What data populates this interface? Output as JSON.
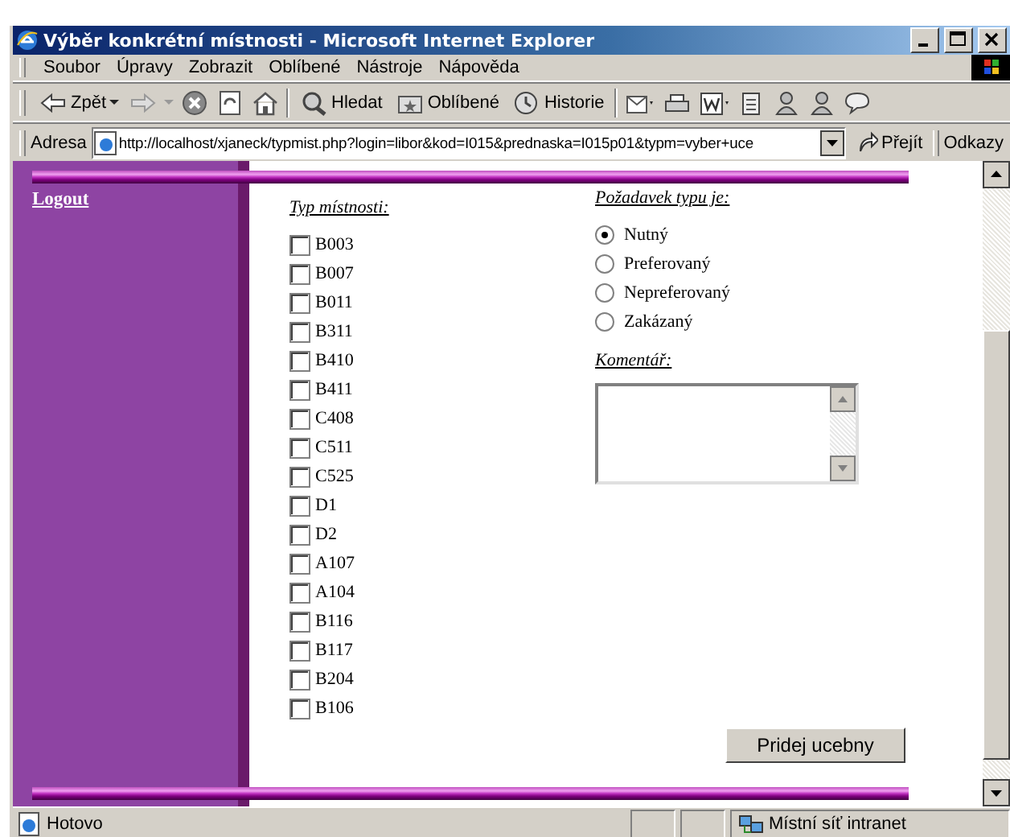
{
  "window": {
    "title": "Výběr konkrétní místnosti - Microsoft Internet Explorer"
  },
  "menu": [
    "Soubor",
    "Úpravy",
    "Zobrazit",
    "Oblíbené",
    "Nástroje",
    "Nápověda"
  ],
  "toolbar": [
    {
      "kind": "back",
      "label": "Zpět"
    },
    {
      "kind": "forward"
    },
    {
      "kind": "stop"
    },
    {
      "kind": "refresh"
    },
    {
      "kind": "home"
    },
    {
      "kind": "search",
      "label": "Hledat"
    },
    {
      "kind": "favorites",
      "label": "Oblíbené"
    },
    {
      "kind": "history",
      "label": "Historie"
    },
    {
      "kind": "mail"
    },
    {
      "kind": "print"
    },
    {
      "kind": "edit"
    },
    {
      "kind": "page"
    },
    {
      "kind": "people"
    },
    {
      "kind": "people"
    },
    {
      "kind": "discuss"
    }
  ],
  "address": {
    "label": "Adresa",
    "url": "http://localhost/xjaneck/typmist.php?login=libor&kod=I015&prednaska=I015p01&typm=vyber+uce",
    "go": "Přejít",
    "links": "Odkazy"
  },
  "sidebar": {
    "logout": "Logout"
  },
  "rooms": {
    "heading": "Typ místnosti:",
    "items": [
      {
        "label": "B003",
        "checked": false
      },
      {
        "label": "B007",
        "checked": false
      },
      {
        "label": "B011",
        "checked": false
      },
      {
        "label": "B311",
        "checked": false
      },
      {
        "label": "B410",
        "checked": false
      },
      {
        "label": "B411",
        "checked": false
      },
      {
        "label": "C408",
        "checked": false
      },
      {
        "label": "C511",
        "checked": false
      },
      {
        "label": "C525",
        "checked": false
      },
      {
        "label": "D1",
        "checked": false
      },
      {
        "label": "D2",
        "checked": false
      },
      {
        "label": "A107",
        "checked": false
      },
      {
        "label": "A104",
        "checked": false
      },
      {
        "label": "B116",
        "checked": false
      },
      {
        "label": "B117",
        "checked": false
      },
      {
        "label": "B204",
        "checked": false
      },
      {
        "label": "B106",
        "checked": false
      }
    ]
  },
  "requirement": {
    "heading": "Požadavek typu je:",
    "options": [
      {
        "label": "Nutný",
        "selected": true
      },
      {
        "label": "Preferovaný",
        "selected": false
      },
      {
        "label": "Nepreferovaný",
        "selected": false
      },
      {
        "label": "Zakázaný",
        "selected": false
      }
    ]
  },
  "comment": {
    "heading": "Komentář:"
  },
  "submit": "Pridej ucebny",
  "status_bar": {
    "text": "Hotovo",
    "zone": "Místní síť intranet"
  }
}
